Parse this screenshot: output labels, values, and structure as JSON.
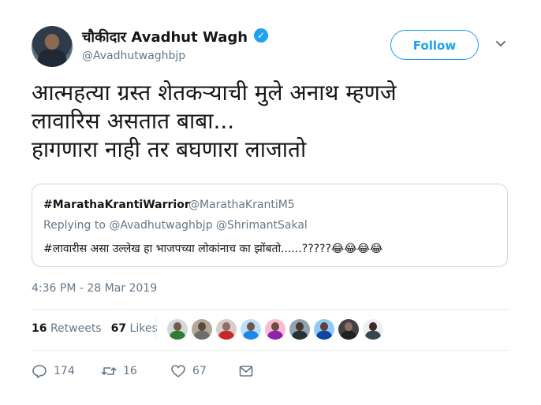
{
  "header": {
    "display_name": "चौकीदार Avadhut Wagh",
    "verified_icon": "verified-badge-icon",
    "handle": "@Avadhutwaghbjp",
    "follow_label": "Follow",
    "menu_icon": "chevron-down-icon"
  },
  "tweet": {
    "lines": [
      "आत्महत्या ग्रस्त शेतकऱ्याची मुले अनाथ म्हणजे",
      "लावारिस असतात बाबा...",
      "हागणारा नाही तर बघणारा लाजातो"
    ]
  },
  "quoted": {
    "name": "#MarathaKrantiWarrior",
    "handle": "@MarathaKrantiM5",
    "replying_prefix": "Replying to",
    "reply_handles": "@Avadhutwaghbjp @ShrimantSakal",
    "text": "#लावारीस असा उल्लेख हा भाजपच्या लोकांनाच का झोंबतो......?????😂😂😂😂"
  },
  "timestamp": "4:36 PM - 28 Mar 2019",
  "stats": {
    "retweets_count": "16",
    "retweets_label": "Retweets",
    "likes_count": "67",
    "likes_label": "Likes"
  },
  "actions": {
    "reply_count": "174",
    "retweet_count": "16",
    "like_count": "67",
    "reply_icon": "reply-icon",
    "retweet_icon": "retweet-icon",
    "like_icon": "heart-icon",
    "dm_icon": "envelope-icon"
  },
  "colors": {
    "accent": "#1da1f2",
    "muted": "#657786",
    "text": "#14171a",
    "border": "#ccd6dd"
  }
}
